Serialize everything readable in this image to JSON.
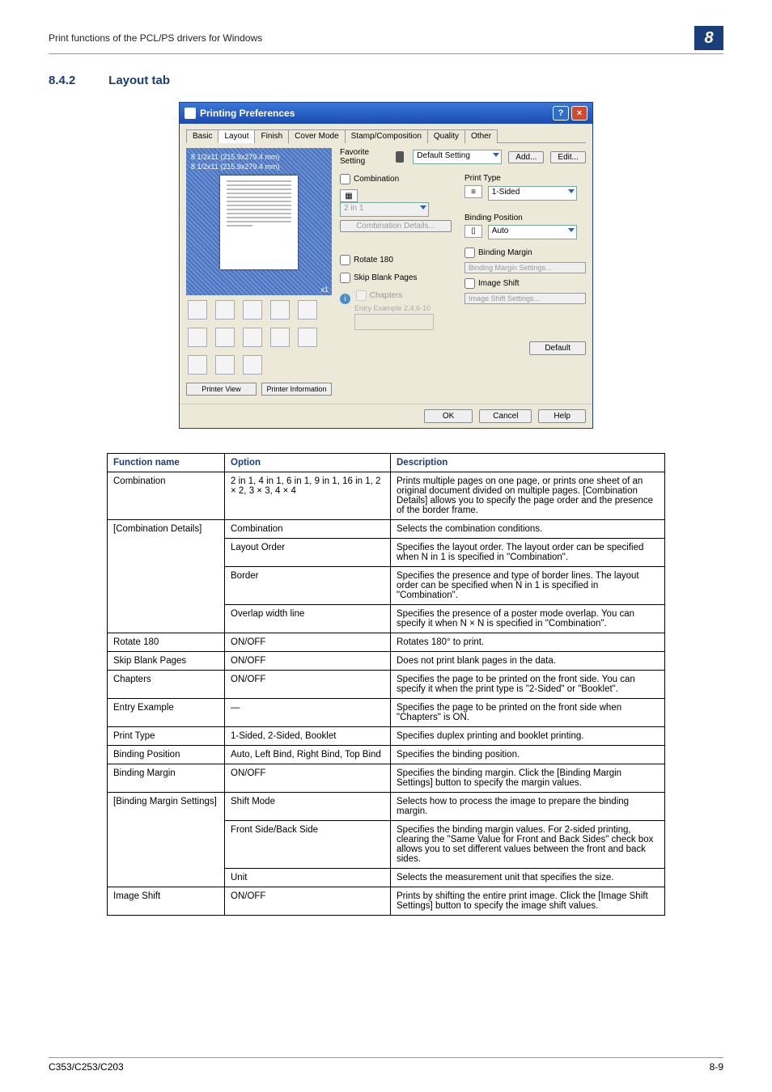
{
  "header": {
    "breadcrumb": "Print functions of the PCL/PS drivers for Windows",
    "chapter": "8"
  },
  "section": {
    "number": "8.4.2",
    "title": "Layout tab"
  },
  "dialog": {
    "title": "Printing Preferences",
    "tabs": [
      "Basic",
      "Layout",
      "Finish",
      "Cover Mode",
      "Stamp/Composition",
      "Quality",
      "Other"
    ],
    "favorite_label": "Favorite Setting",
    "favorite_value": "Default Setting",
    "add_btn": "Add...",
    "edit_btn": "Edit...",
    "size1": "8 1/2x11 (215.9x279.4 mm)",
    "size2": "8 1/2x11 (215.9x279.4 mm)",
    "zoom": "x1",
    "printer_view": "Printer View",
    "printer_info": "Printer Information",
    "combination": "Combination",
    "comb_sel": "2 in 1",
    "comb_details": "Combination Details...",
    "rotate180": "Rotate 180",
    "skip_blank": "Skip Blank Pages",
    "chapters": "Chapters",
    "entry_example": "Entry Example 2,4,6-10",
    "print_type_lbl": "Print Type",
    "print_type_val": "1-Sided",
    "binding_pos_lbl": "Binding Position",
    "binding_pos_val": "Auto",
    "binding_margin": "Binding Margin",
    "binding_margin_settings": "Binding Margin Settings...",
    "image_shift": "Image Shift",
    "image_shift_settings": "Image Shift Settings...",
    "default_btn": "Default",
    "ok": "OK",
    "cancel": "Cancel",
    "help": "Help"
  },
  "table": {
    "headers": [
      "Function name",
      "Option",
      "Description"
    ],
    "rows": [
      {
        "fn": "Combination",
        "opt": "2 in 1, 4 in 1, 6 in 1, 9 in 1, 16 in 1, 2 × 2, 3 × 3, 4 × 4",
        "desc": "Prints multiple pages on one page, or prints one sheet of an original document divided on multiple pages. [Combination Details] allows you to specify the page order and the presence of the border frame."
      },
      {
        "fn": "[Combination Details]",
        "fn_rowspan": 4,
        "opt": "Combination",
        "desc": "Selects the combination conditions."
      },
      {
        "opt": "Layout Order",
        "desc": "Specifies the layout order. The layout order can be specified when N in 1 is specified in \"Combination\"."
      },
      {
        "opt": "Border",
        "desc": "Specifies the presence and type of border lines. The layout order can be specified when N in 1 is specified in \"Combination\"."
      },
      {
        "opt": "Overlap width line",
        "desc": "Specifies the presence of a poster mode overlap. You can specify it when N × N is specified in \"Combination\"."
      },
      {
        "fn": "Rotate 180",
        "opt": "ON/OFF",
        "desc": "Rotates 180° to print."
      },
      {
        "fn": "Skip Blank Pages",
        "opt": "ON/OFF",
        "desc": "Does not print blank pages in the data."
      },
      {
        "fn": "Chapters",
        "opt": "ON/OFF",
        "desc": "Specifies the page to be printed on the front side. You can specify it when the print type is \"2-Sided\" or \"Booklet\"."
      },
      {
        "fn": "Entry Example",
        "opt": "—",
        "desc": "Specifies the page to be printed on the front side when \"Chapters\" is ON."
      },
      {
        "fn": "Print Type",
        "opt": "1-Sided, 2-Sided, Booklet",
        "desc": "Specifies duplex printing and booklet printing."
      },
      {
        "fn": "Binding Position",
        "opt": "Auto, Left Bind, Right Bind, Top Bind",
        "desc": "Specifies the binding position."
      },
      {
        "fn": "Binding Margin",
        "opt": "ON/OFF",
        "desc": "Specifies the binding margin. Click the [Binding Margin Settings] button to specify the margin values."
      },
      {
        "fn": "[Binding Margin Settings]",
        "fn_rowspan": 3,
        "opt": "Shift Mode",
        "desc": "Selects how to process the image to prepare the binding margin."
      },
      {
        "opt": "Front Side/Back Side",
        "desc": "Specifies the binding margin values. For 2-sided printing, clearing the \"Same Value for Front and Back Sides\" check box allows you to set different values between the front and back sides."
      },
      {
        "opt": "Unit",
        "desc": "Selects the measurement unit that specifies the size."
      },
      {
        "fn": "Image Shift",
        "opt": "ON/OFF",
        "desc": "Prints by shifting the entire print image. Click the [Image Shift Settings] button to specify the image shift values."
      }
    ]
  },
  "footer": {
    "model": "C353/C253/C203",
    "page": "8-9"
  }
}
